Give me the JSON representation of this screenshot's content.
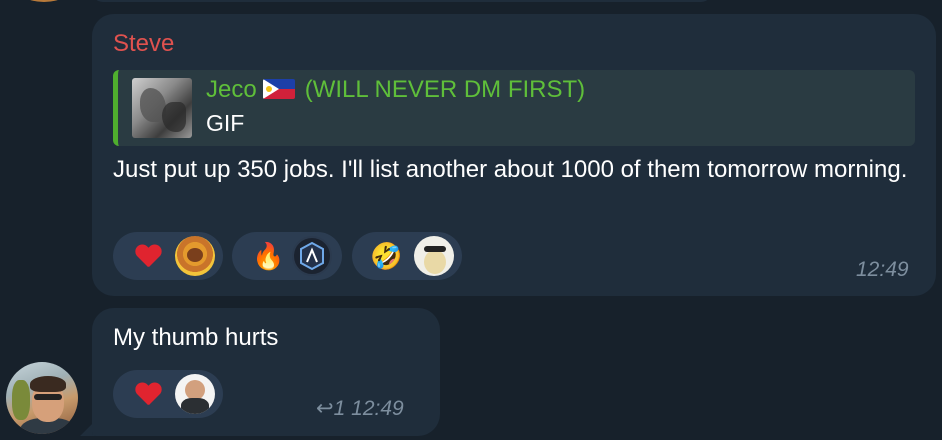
{
  "message1": {
    "sender": "Steve",
    "reply": {
      "name": "Jeco",
      "flag_emoji": "🇵🇭",
      "tag": "(WILL NEVER DM FIRST)",
      "text": "GIF"
    },
    "text": "Just put up 350 jobs. I'll list another about 1000 of them tomorrow morning.",
    "reactions": [
      {
        "emoji": "heart-icon",
        "glyph": "❤"
      },
      {
        "emoji": "fire-icon",
        "glyph": "🔥"
      },
      {
        "emoji": "rofl-icon",
        "glyph": "🤣"
      }
    ],
    "time": "12:49"
  },
  "message2": {
    "text": "My thumb hurts",
    "reactions": [
      {
        "emoji": "heart-icon",
        "glyph": "❤"
      }
    ],
    "replies_count": "1",
    "time": "12:49"
  },
  "colors": {
    "background": "#17212b",
    "bubble": "#1f2d3b",
    "sender": "#e0524f",
    "reply_accent": "#4fae2e",
    "reaction_bg": "#2c3d52",
    "time": "#7d8e9e"
  }
}
